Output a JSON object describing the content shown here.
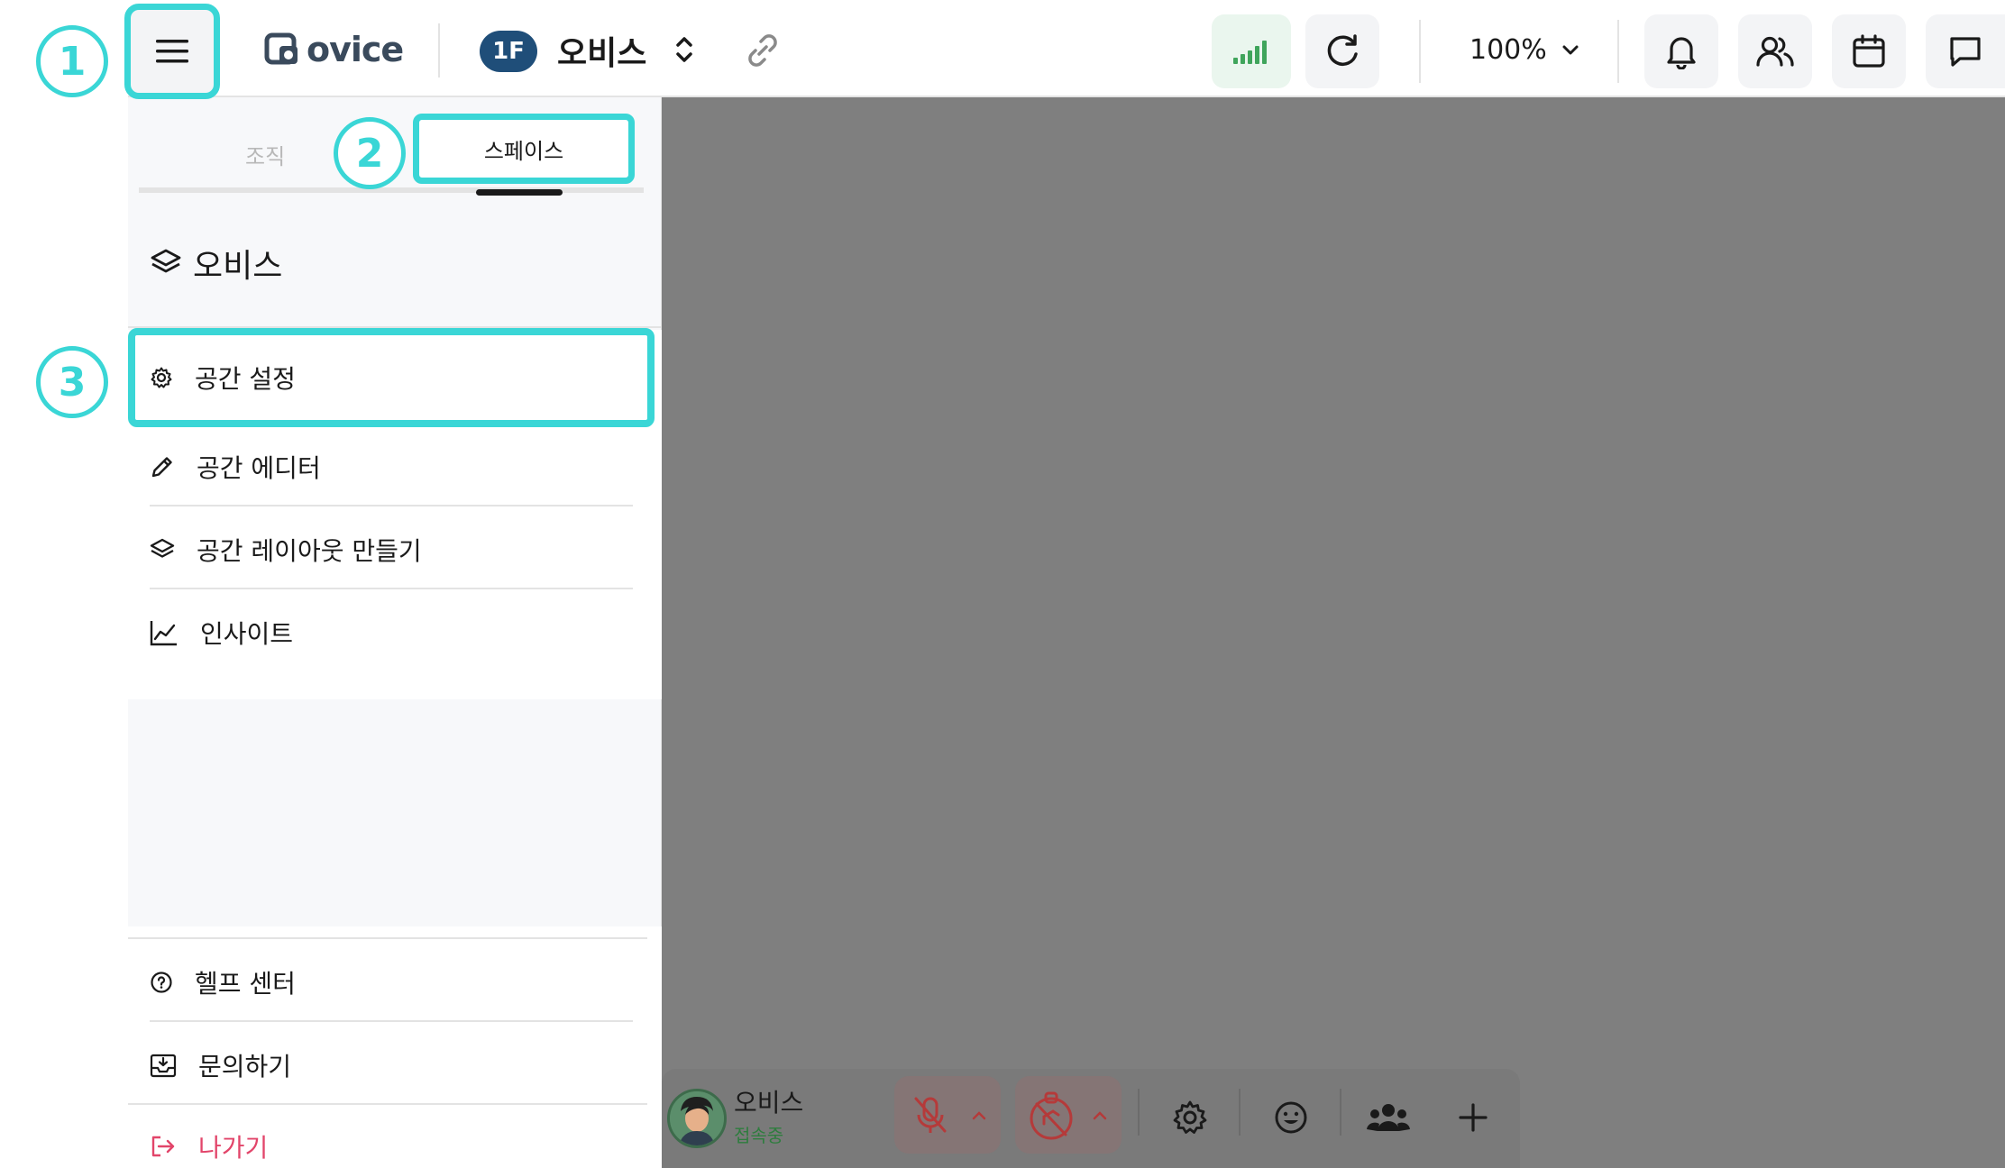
{
  "header": {
    "logo_text": "ovice",
    "floor_badge": "1F",
    "space_name": "오비스",
    "zoom_level": "100%"
  },
  "steps": [
    "1",
    "2",
    "3"
  ],
  "sidebar": {
    "tabs": [
      {
        "label": "조직"
      },
      {
        "label": "스페이스"
      }
    ],
    "space_title": "오비스",
    "items": [
      {
        "label": "공간 설정",
        "icon": "gear-icon"
      },
      {
        "label": "공간 에디터",
        "icon": "pencil-icon"
      },
      {
        "label": "공간 레이아웃 만들기",
        "icon": "layers-icon"
      },
      {
        "label": "인사이트",
        "icon": "chart-line-icon"
      }
    ],
    "bottom_items": [
      {
        "label": "헬프 센터",
        "icon": "help-circle-icon"
      },
      {
        "label": "문의하기",
        "icon": "inbox-icon"
      },
      {
        "label": "나가기",
        "icon": "exit-icon"
      }
    ]
  },
  "footer_toolbar": {
    "user_name": "오비스",
    "user_status": "접속중"
  },
  "colors": {
    "highlight": "#3ad6d6",
    "floor_badge": "#1f4e79",
    "exit_text": "#e2456a",
    "status_text": "#2e7d3e",
    "signal_green": "#3fa55b"
  }
}
